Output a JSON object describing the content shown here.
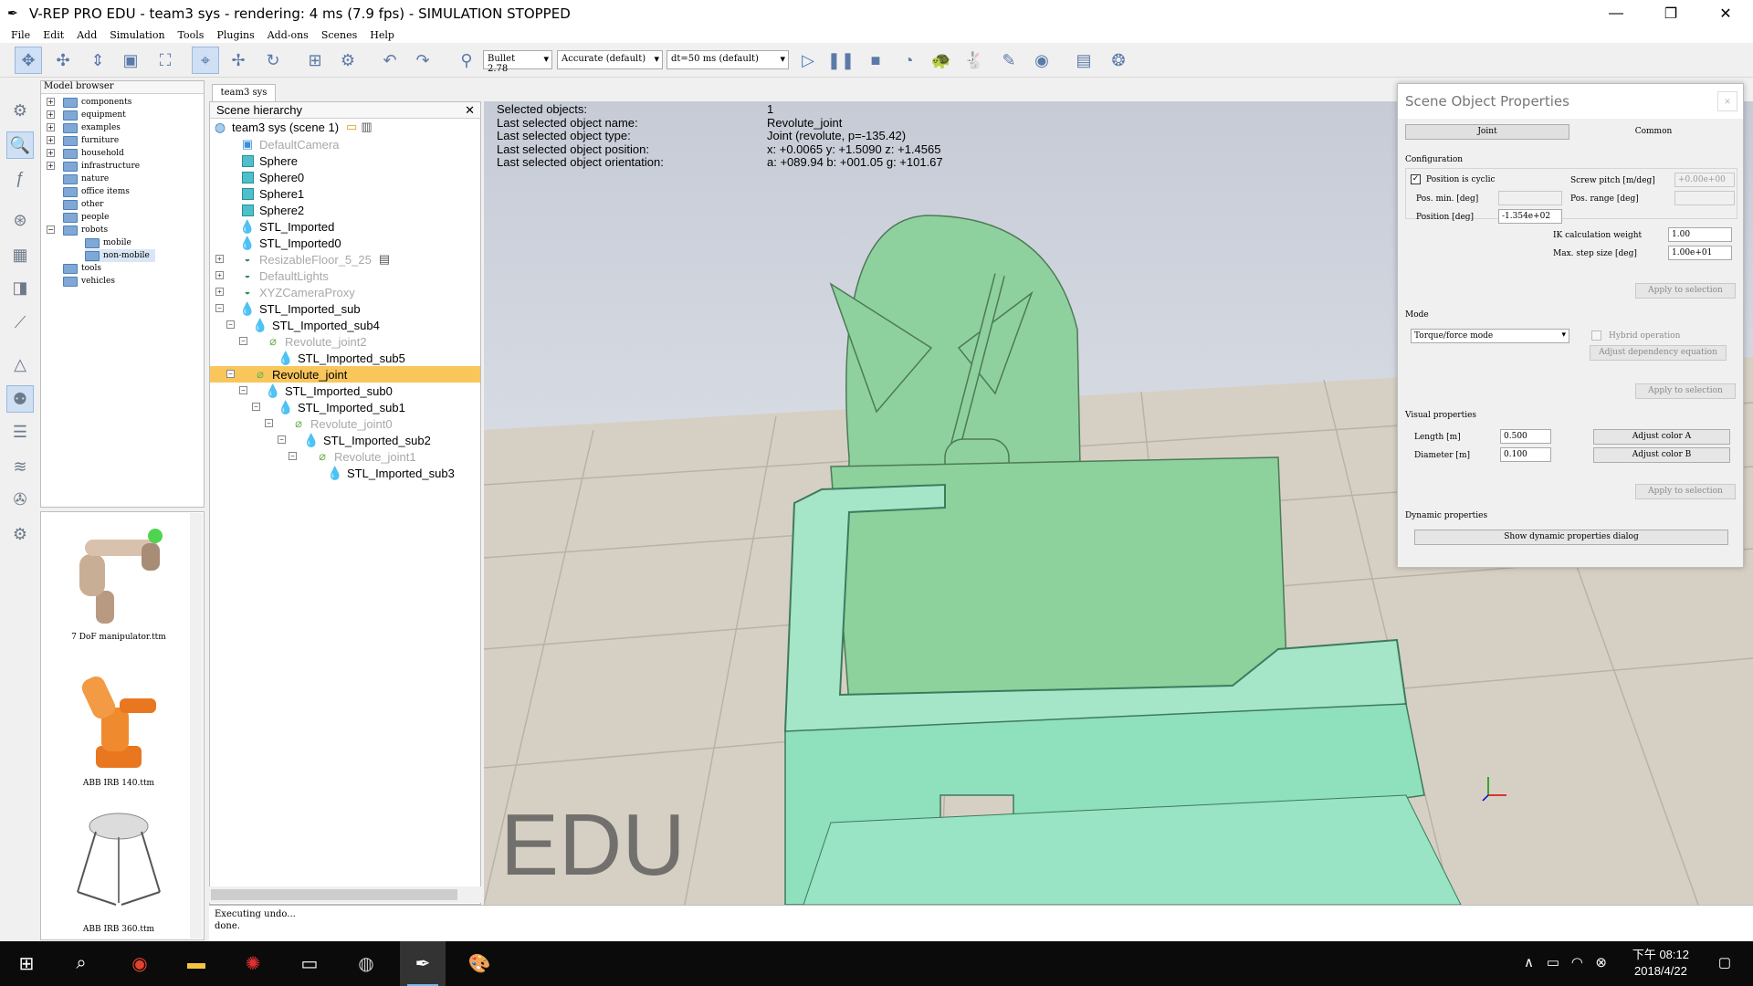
{
  "window": {
    "title": "V-REP PRO EDU - team3 sys - rendering: 4 ms (7.9 fps) - SIMULATION STOPPED",
    "minimize": "—",
    "restore": "❐",
    "close": "✕"
  },
  "menu": [
    "File",
    "Edit",
    "Add",
    "Simulation",
    "Tools",
    "Plugins",
    "Add-ons",
    "Scenes",
    "Help"
  ],
  "toolbar": {
    "engine": "Bullet 2.78",
    "accuracy": "Accurate (default)",
    "timestep": "dt=50 ms (default)"
  },
  "model_browser": {
    "header": "Model browser",
    "items": [
      "components",
      "equipment",
      "examples",
      "furniture",
      "household",
      "infrastructure",
      "nature",
      "office items",
      "other",
      "people",
      "robots",
      "mobile",
      "non-mobile",
      "tools",
      "vehicles"
    ],
    "thumbnails": [
      "7 DoF manipulator.ttm",
      "ABB IRB 140.ttm",
      "ABB IRB 360.ttm"
    ]
  },
  "scene_tab": "team3 sys",
  "hierarchy": {
    "header": "Scene hierarchy",
    "items": [
      "team3 sys (scene 1)",
      "DefaultCamera",
      "Sphere",
      "Sphere0",
      "Sphere1",
      "Sphere2",
      "STL_Imported",
      "STL_Imported0",
      "ResizableFloor_5_25",
      "DefaultLights",
      "XYZCameraProxy",
      "STL_Imported_sub",
      "STL_Imported_sub4",
      "Revolute_joint2",
      "STL_Imported_sub5",
      "Revolute_joint",
      "STL_Imported_sub0",
      "STL_Imported_sub1",
      "Revolute_joint0",
      "STL_Imported_sub2",
      "Revolute_joint1",
      "STL_Imported_sub3"
    ]
  },
  "info": {
    "labels": [
      "Selected objects:",
      "Last selected object name:",
      "Last selected object type:",
      "Last selected object position:",
      "Last selected object orientation:"
    ],
    "values": [
      "1",
      "Revolute_joint",
      "Joint (revolute, p=-135.42)",
      "x: +0.0065    y: +1.5090    z: +1.4565",
      "a: +089.94    b: +001.05    g: +101.67"
    ]
  },
  "watermark": "EDU",
  "properties": {
    "title": "Scene Object Properties",
    "close": "×",
    "tabs": [
      "Joint",
      "Common"
    ],
    "configuration": "Configuration",
    "cyclic": "Position is cyclic",
    "screw_pitch_label": "Screw pitch [m/deg]",
    "screw_pitch": "+0.00e+00",
    "pos_min_label": "Pos. min. [deg]",
    "pos_range_label": "Pos. range [deg]",
    "position_label": "Position [deg]",
    "position": "-1.354e+02",
    "ik_weight_label": "IK calculation weight",
    "ik_weight": "1.00",
    "max_step_label": "Max. step size [deg]",
    "max_step": "1.00e+01",
    "apply": "Apply to selection",
    "mode": "Mode",
    "mode_value": "Torque/force mode",
    "hybrid": "Hybrid operation",
    "dependency": "Adjust dependency equation",
    "visual": "Visual properties",
    "length_label": "Length [m]",
    "length": "0.500",
    "diameter_label": "Diameter [m]",
    "diameter": "0.100",
    "color_a": "Adjust color A",
    "color_b": "Adjust color B",
    "dynamic": "Dynamic properties",
    "dynamic_btn": "Show dynamic properties dialog"
  },
  "status": [
    "Executing undo...",
    "done."
  ],
  "taskbar": {
    "time": "下午 08:12",
    "date": "2018/4/22"
  }
}
